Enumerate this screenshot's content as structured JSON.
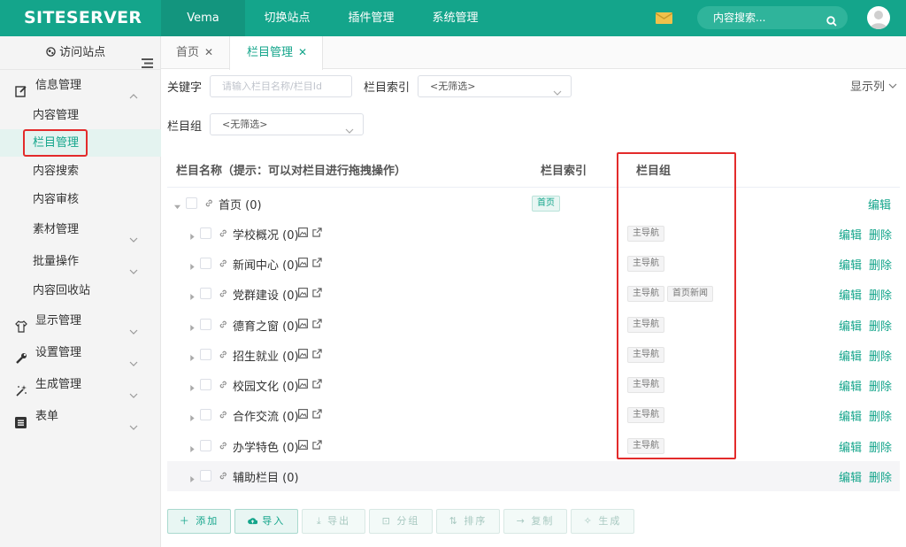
{
  "brand": {
    "logo": "SITESERVER",
    "accent": "#14a58b",
    "highlight": "#e32b2b"
  },
  "topnav": [
    "Vema",
    "切换站点",
    "插件管理",
    "系统管理"
  ],
  "search": {
    "placeholder": "内容搜索..."
  },
  "sidebar": {
    "visit": "访问站点",
    "info_group": "信息管理",
    "items": [
      "内容管理",
      "栏目管理",
      "内容搜索",
      "内容审核",
      "素材管理",
      "批量操作",
      "内容回收站"
    ],
    "groups": [
      "显示管理",
      "设置管理",
      "生成管理",
      "表单"
    ]
  },
  "tabs": [
    "首页",
    "栏目管理"
  ],
  "filters": {
    "keyword_label": "关键字",
    "keyword_placeholder": "请输入栏目名称/栏目Id",
    "index_label": "栏目索引",
    "index_value": "<无筛选>",
    "group_label": "栏目组",
    "group_value": "<无筛选>",
    "show_columns": "显示列"
  },
  "table": {
    "headers": [
      "栏目名称（提示：可以对栏目进行拖拽操作）",
      "栏目索引",
      "栏目组"
    ],
    "root": {
      "name": "首页 (0)",
      "index_tag": "首页",
      "edit": "编辑"
    },
    "rows": [
      {
        "name": "学校概况 (0)",
        "tags": [
          "主导航"
        ]
      },
      {
        "name": "新闻中心 (0)",
        "tags": [
          "主导航"
        ]
      },
      {
        "name": "党群建设 (0)",
        "tags": [
          "主导航",
          "首页新闻"
        ]
      },
      {
        "name": "德育之窗 (0)",
        "tags": [
          "主导航"
        ]
      },
      {
        "name": "招生就业 (0)",
        "tags": [
          "主导航"
        ]
      },
      {
        "name": "校园文化 (0)",
        "tags": [
          "主导航"
        ]
      },
      {
        "name": "合作交流 (0)",
        "tags": [
          "主导航"
        ]
      },
      {
        "name": "办学特色 (0)",
        "tags": [
          "主导航"
        ]
      },
      {
        "name": "辅助栏目 (0)",
        "tags": []
      }
    ],
    "edit": "编辑",
    "delete": "删除"
  },
  "toolbar": [
    "添加",
    "导入",
    "导出",
    "分组",
    "排序",
    "复制",
    "生成"
  ]
}
